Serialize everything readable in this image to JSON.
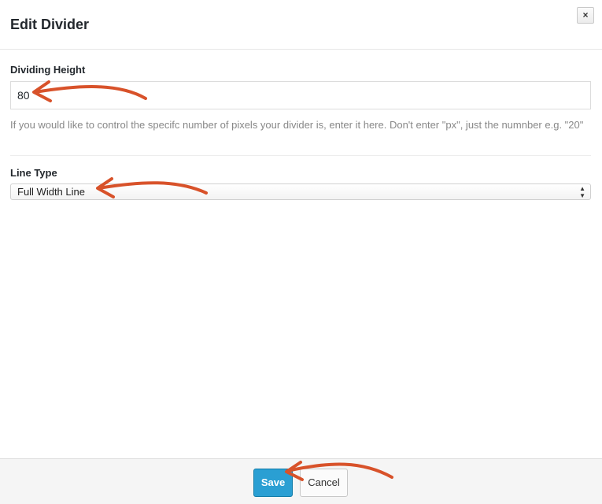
{
  "dialog": {
    "title": "Edit Divider",
    "close_label": "×"
  },
  "fields": {
    "height": {
      "label": "Dividing Height",
      "value": "80",
      "description": "If you would like to control the specifc number of pixels your divider is, enter it here. Don't enter \"px\", just the numnber e.g. \"20\""
    },
    "line_type": {
      "label": "Line Type",
      "selected": "Full Width Line"
    }
  },
  "footer": {
    "save_label": "Save",
    "cancel_label": "Cancel"
  },
  "annotations": {
    "arrow_color": "#d8522a"
  },
  "colors": {
    "save_button": "#2a9fd3"
  }
}
